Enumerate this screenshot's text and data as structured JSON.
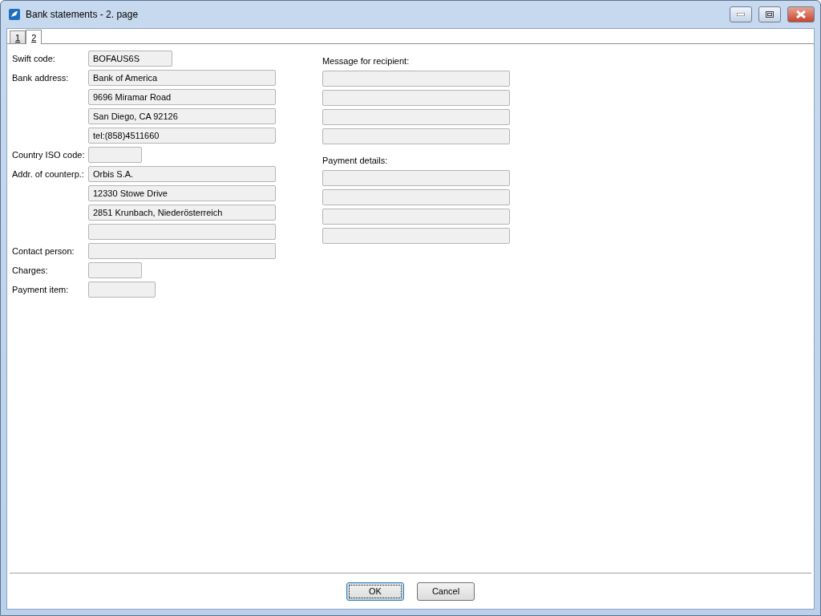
{
  "window": {
    "title": "Bank statements - 2. page"
  },
  "tabs": [
    {
      "label": "1",
      "selected": false
    },
    {
      "label": "2",
      "selected": true
    }
  ],
  "left_rows": [
    {
      "label": "Swift code:",
      "fields": [
        {
          "kind": "medium",
          "value": "BOFAUS6S"
        }
      ]
    },
    {
      "label": "Bank address:",
      "fields": [
        {
          "kind": "wide",
          "value": "Bank of America"
        },
        {
          "kind": "wide",
          "value": "9696 Miramar Road"
        },
        {
          "kind": "wide",
          "value": "San Diego, CA 92126"
        },
        {
          "kind": "wide",
          "value": "tel:(858)4511660"
        }
      ]
    },
    {
      "label": "Country ISO code:",
      "fields": [
        {
          "kind": "small"
        }
      ]
    },
    {
      "label": "Addr. of counterp.:",
      "fields": [
        {
          "kind": "wide",
          "value": "Orbis S.A."
        },
        {
          "kind": "wide",
          "value": "12330 Stowe Drive"
        },
        {
          "kind": "wide",
          "value": "2851 Krunbach, Niederösterreich"
        },
        {
          "kind": "wide"
        }
      ]
    },
    {
      "label": "Contact person:",
      "fields": [
        {
          "kind": "wide"
        }
      ]
    },
    {
      "label": "Charges:",
      "fields": [
        {
          "kind": "small"
        }
      ]
    },
    {
      "label": "Payment item:",
      "fields": [
        {
          "kind": "item"
        }
      ]
    }
  ],
  "right_groups": [
    {
      "label": "Message for recipient:",
      "fields": [
        {
          "kind": "wide"
        },
        {
          "kind": "wide"
        },
        {
          "kind": "wide"
        },
        {
          "kind": "wide"
        }
      ]
    },
    {
      "label": "Payment details:",
      "fields": [
        {
          "kind": "wide"
        },
        {
          "kind": "wide"
        },
        {
          "kind": "wide"
        },
        {
          "kind": "wide"
        }
      ]
    }
  ],
  "buttons": [
    {
      "label": "OK",
      "selected": true
    },
    {
      "label": "Cancel",
      "selected": false
    }
  ]
}
